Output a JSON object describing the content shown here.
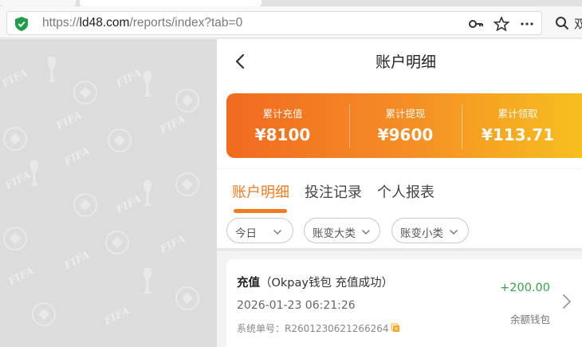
{
  "browser": {
    "url_prefix": "https://",
    "url_host": "ld48.com",
    "url_path": "/reports/index?tab=0",
    "search_label": "双"
  },
  "pattern": {
    "watermark_text": "FIFA"
  },
  "page": {
    "title": "账户明细"
  },
  "summary": {
    "accent_start": "#f16a20",
    "accent_end": "#f7c21e",
    "items": [
      {
        "label": "累计充值",
        "value": "¥8100"
      },
      {
        "label": "累计提现",
        "value": "¥9600"
      },
      {
        "label": "累计领取",
        "value": "¥113.71"
      }
    ]
  },
  "tabs": [
    {
      "label": "账户明细",
      "active": true
    },
    {
      "label": "投注记录",
      "active": false
    },
    {
      "label": "个人报表",
      "active": false
    }
  ],
  "filters": [
    {
      "label": "今日"
    },
    {
      "label": "账变大类"
    },
    {
      "label": "账变小类"
    }
  ],
  "record": {
    "type": "充值",
    "detail": "（Okpay钱包 充值成功）",
    "time": "2026-01-23 06:21:26",
    "order_label": "系统单号：",
    "order_no": "R2601230621266264",
    "amount": "+200.00",
    "wallet": "余额钱包",
    "amount_color": "#3aa14a"
  }
}
